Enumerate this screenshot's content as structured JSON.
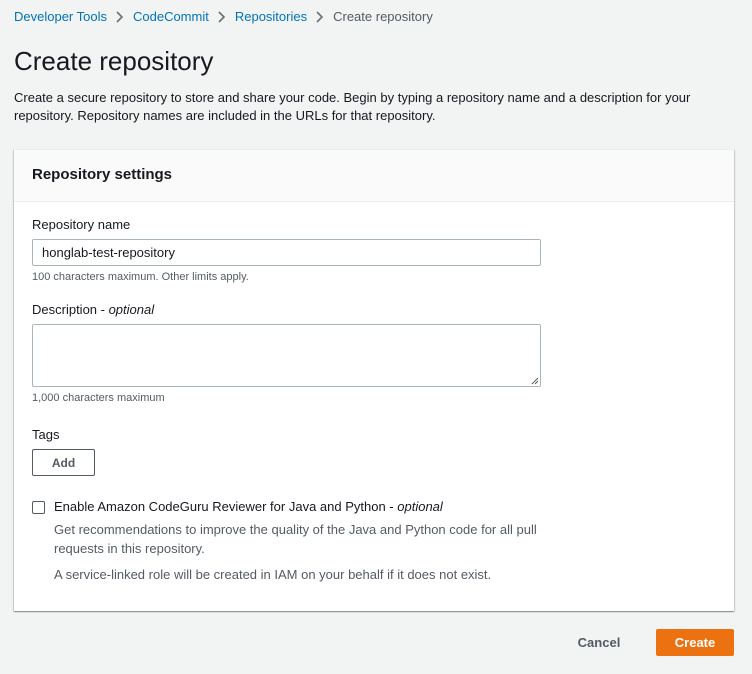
{
  "breadcrumb": {
    "items": [
      {
        "label": "Developer Tools"
      },
      {
        "label": "CodeCommit"
      },
      {
        "label": "Repositories"
      }
    ],
    "current": "Create repository"
  },
  "page": {
    "title": "Create repository",
    "description": "Create a secure repository to store and share your code. Begin by typing a repository name and a description for your repository. Repository names are included in the URLs for that repository."
  },
  "settings": {
    "title": "Repository settings",
    "repo_name": {
      "label": "Repository name",
      "value": "honglab-test-repository",
      "hint": "100 characters maximum. Other limits apply."
    },
    "description": {
      "label": "Description - ",
      "label_optional": "optional",
      "value": "",
      "hint": "1,000 characters maximum"
    },
    "tags": {
      "label": "Tags",
      "add_button": "Add"
    },
    "codeguru": {
      "checked": false,
      "label": "Enable Amazon CodeGuru Reviewer for Java and Python - ",
      "label_optional": "optional",
      "desc1": "Get recommendations to improve the quality of the Java and Python code for all pull requests in this repository.",
      "desc2": "A service-linked role will be created in IAM on your behalf if it does not exist."
    }
  },
  "actions": {
    "cancel": "Cancel",
    "create": "Create"
  },
  "colors": {
    "link": "#0073bb",
    "primary": "#ec7211",
    "background": "#f2f3f3"
  },
  "icons": {
    "breadcrumb_separator": "chevron-right-icon",
    "textarea_resize": "resize-grip-icon"
  }
}
